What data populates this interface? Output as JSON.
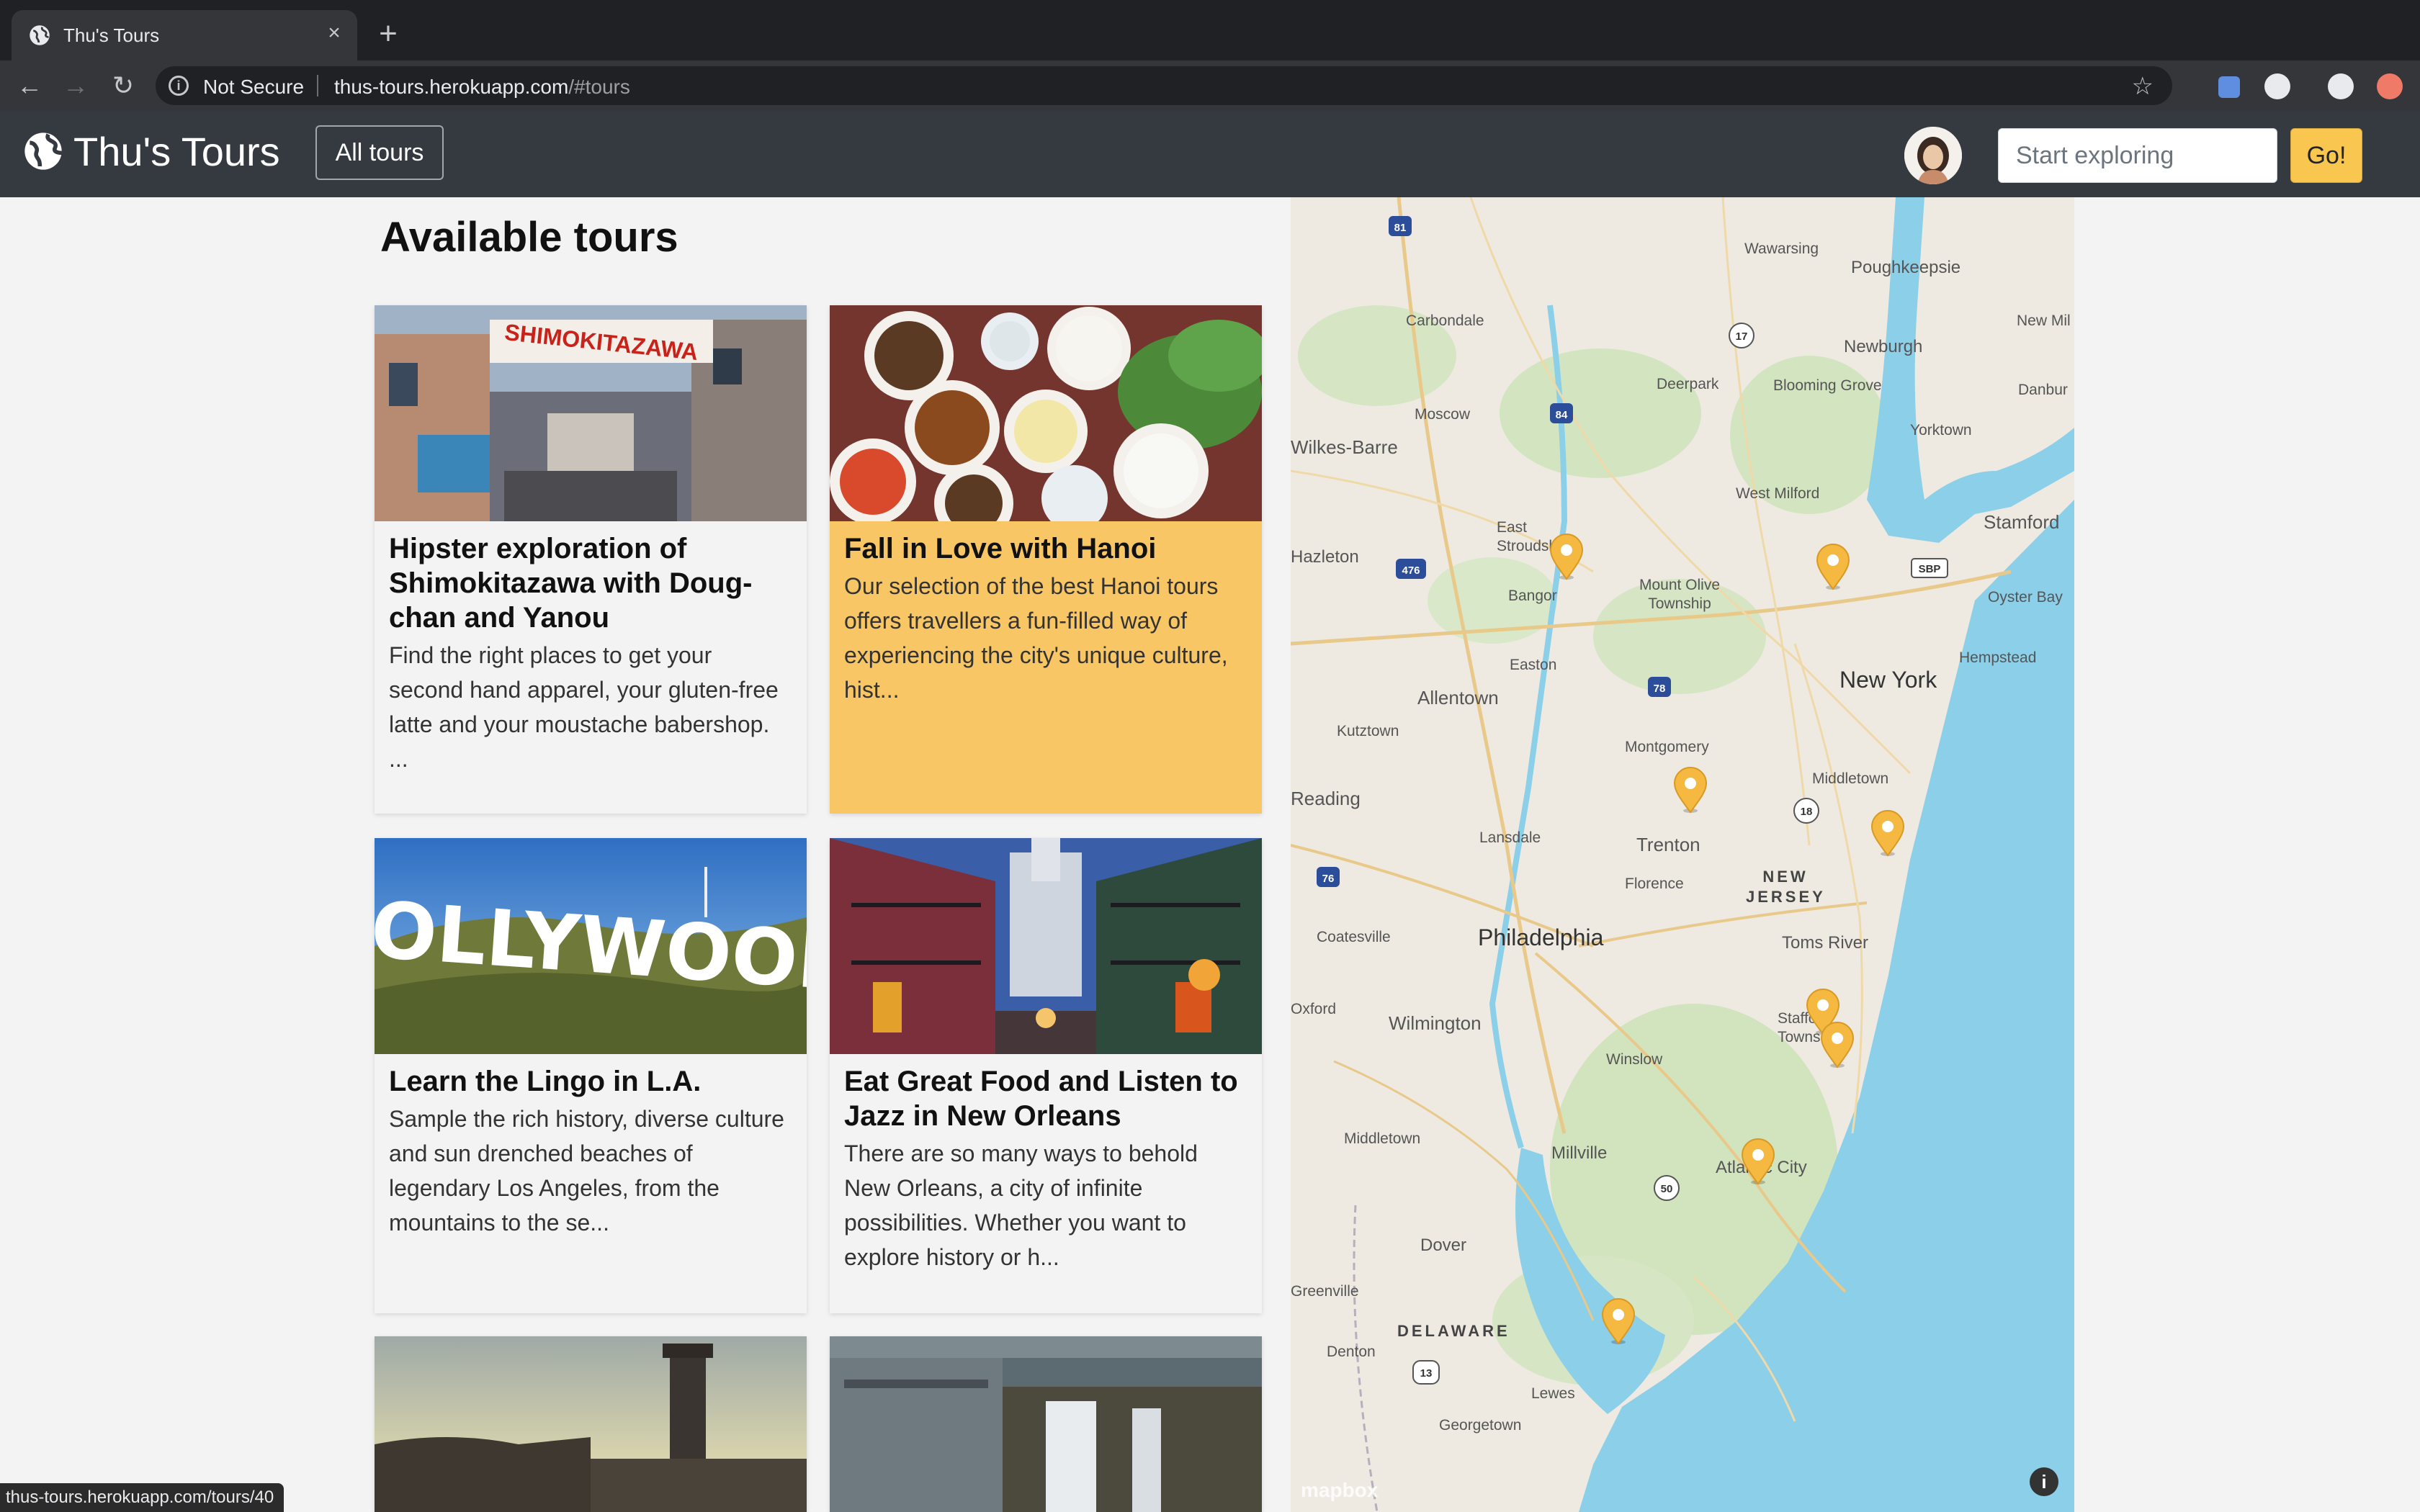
{
  "browser": {
    "tab_title": "Thu's Tours",
    "not_secure_label": "Not Secure",
    "url_host": "thus-tours.herokuapp.com",
    "url_path": "/#tours"
  },
  "navbar": {
    "brand": "Thu's Tours",
    "all_tours_label": "All tours",
    "search_placeholder": "Start exploring",
    "go_label": "Go!"
  },
  "main": {
    "heading": "Available tours",
    "tours": [
      {
        "title": "Hipster exploration of Shimokitazawa with Doug-chan and Yanou",
        "description": "Find the right places to get your second hand apparel, your gluten-free latte and your moustache babershop. ...",
        "highlighted": false
      },
      {
        "title": "Fall in Love with Hanoi",
        "description": "Our selection of the best Hanoi tours offers travellers a fun-filled way of experiencing the city's unique culture, hist...",
        "highlighted": true
      },
      {
        "title": "Learn the Lingo in L.A.",
        "description": "Sample the rich history, diverse culture and sun drenched beaches of legendary Los Angeles, from the mountains to the se...",
        "highlighted": false
      },
      {
        "title": "Eat Great Food and Listen to Jazz in New Orleans",
        "description": "There are so many ways to behold New Orleans, a city of infinite possibilities. Whether you want to explore history or h...",
        "highlighted": false
      }
    ],
    "hollywood_sign_text": "HOLLYWOOD",
    "shimokitazawa_sign_text": "SHIMOKITAZAWA"
  },
  "map": {
    "attribution": "mapbox",
    "places": [
      {
        "name": "Wawarsing"
      },
      {
        "name": "Poughkeepsie"
      },
      {
        "name": "Carbondale"
      },
      {
        "name": "Newburgh"
      },
      {
        "name": "New Mil"
      },
      {
        "name": "Deerpark"
      },
      {
        "name": "Blooming Grove"
      },
      {
        "name": "Danbur"
      },
      {
        "name": "Moscow"
      },
      {
        "name": "Yorktown"
      },
      {
        "name": "Wilkes-Barre"
      },
      {
        "name": "West Milford"
      },
      {
        "name": "Stamford"
      },
      {
        "name": "East Stroudsburg"
      },
      {
        "name": "Mount Olive Township"
      },
      {
        "name": "Hazleton"
      },
      {
        "name": "Bangor"
      },
      {
        "name": "Oyster Bay"
      },
      {
        "name": "Hempstead"
      },
      {
        "name": "Easton"
      },
      {
        "name": "New York"
      },
      {
        "name": "Allentown"
      },
      {
        "name": "Kutztown"
      },
      {
        "name": "Montgomery"
      },
      {
        "name": "Middletown"
      },
      {
        "name": "Reading"
      },
      {
        "name": "Lansdale"
      },
      {
        "name": "Trenton"
      },
      {
        "name": "NEW JERSEY"
      },
      {
        "name": "Florence"
      },
      {
        "name": "Coatesville"
      },
      {
        "name": "Philadelphia"
      },
      {
        "name": "Toms River"
      },
      {
        "name": "Oxford"
      },
      {
        "name": "Wilmington"
      },
      {
        "name": "Stafford Township"
      },
      {
        "name": "Winslow"
      },
      {
        "name": "Middletown"
      },
      {
        "name": "Millville"
      },
      {
        "name": "Atlantic City"
      },
      {
        "name": "Dover"
      },
      {
        "name": "Greenville"
      },
      {
        "name": "DELAWARE"
      },
      {
        "name": "Denton"
      },
      {
        "name": "Lewes"
      },
      {
        "name": "Georgetown"
      }
    ],
    "shields": [
      "81",
      "84",
      "476",
      "17",
      "78",
      "18",
      "76",
      "50",
      "13",
      "SBP"
    ]
  },
  "status_url": "thus-tours.herokuapp.com/tours/40",
  "colors": {
    "highlight": "#f8c665",
    "navbar": "#343a40",
    "go_button": "#f9c64f",
    "pin": "#f5b942"
  }
}
